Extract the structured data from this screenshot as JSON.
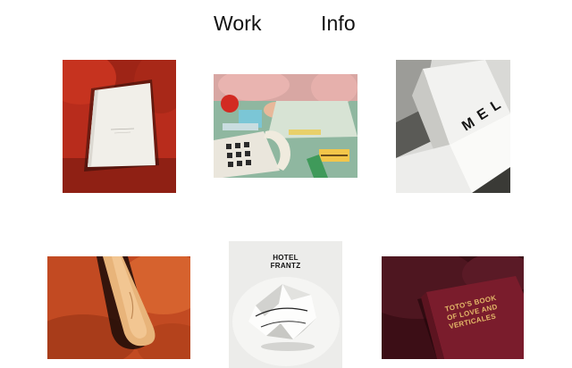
{
  "nav": {
    "work_label": "Work",
    "info_label": "Info"
  },
  "projects": [
    {
      "name": "card-on-red-chair"
    },
    {
      "name": "desk-with-phone"
    },
    {
      "name": "white-boxes-mel"
    },
    {
      "name": "glove-on-leather"
    },
    {
      "name": "hotel-frantz-book",
      "title_text": "HOTEL FRANTZ"
    },
    {
      "name": "totos-book",
      "title_text": "TOTO'S BOOK OF LOVE AND VERTICALES"
    }
  ],
  "colors": {
    "background": "#ffffff",
    "nav_text": "#111111"
  }
}
